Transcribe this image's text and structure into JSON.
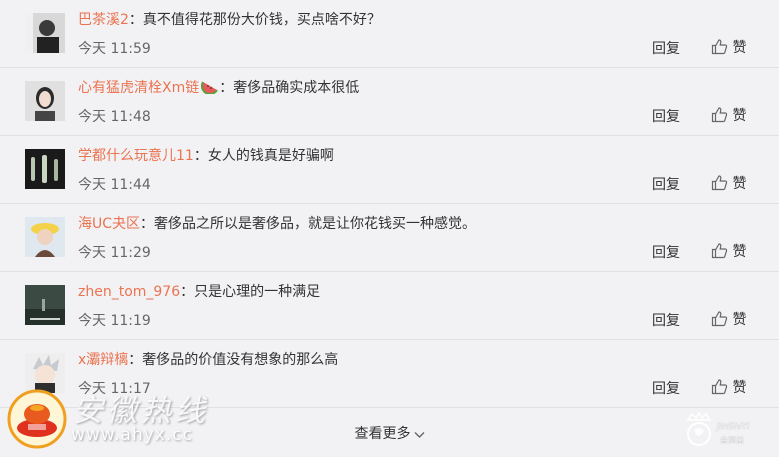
{
  "comments": [
    {
      "user": "巴茶溪2",
      "text": "：真不值得花那份大价钱，买点啥不好？",
      "time": "今天 11:59",
      "reply": "回复",
      "like": "赞",
      "avatar": "person-dark-avatar"
    },
    {
      "user": "心有猛虎清栓Xm链",
      "text": "：奢侈品确实成本很低",
      "time": "今天 11:48",
      "reply": "回复",
      "like": "赞",
      "avatar": "woman-portrait-avatar",
      "emoji": "watermelon-emoji"
    },
    {
      "user": "学都什么玩意儿11",
      "text": "：女人的钱真是好骗啊",
      "time": "今天 11:44",
      "reply": "回复",
      "like": "赞",
      "avatar": "figures-dark-avatar"
    },
    {
      "user": "海UC夬区",
      "text": "：奢侈品之所以是奢侈品，就是让你花钱买一种感觉。",
      "time": "今天 11:29",
      "reply": "回复",
      "like": "赞",
      "avatar": "girl-hat-avatar"
    },
    {
      "user": "zhen_tom_976",
      "text": "：只是心理的一种满足",
      "time": "今天 11:19",
      "reply": "回复",
      "like": "赞",
      "avatar": "landscape-avatar"
    },
    {
      "user": "x灞辩樆",
      "text": "：奢侈品的价值没有想象的那么高",
      "time": "今天 11:17",
      "reply": "回复",
      "like": "赞",
      "avatar": "anime-avatar"
    }
  ],
  "more": {
    "label": "查看更多"
  },
  "watermark": {
    "site_name": "安徽热线",
    "url": "www.ahyx.cc",
    "brand_latin": "JinShiYi",
    "brand_cn": "金狮益"
  },
  "colors": {
    "username": "#eb7350",
    "background": "#f2f2f5"
  }
}
